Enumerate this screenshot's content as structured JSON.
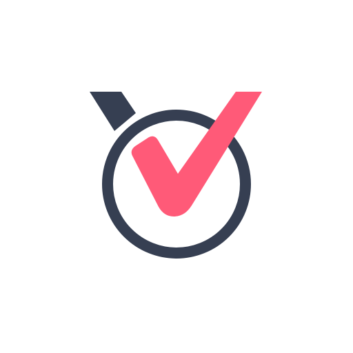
{
  "logo": {
    "icon": "check-ring-logo-icon",
    "colors": {
      "ring": "#363f52",
      "check": "#ff5a78",
      "background": "#ffffff"
    }
  }
}
